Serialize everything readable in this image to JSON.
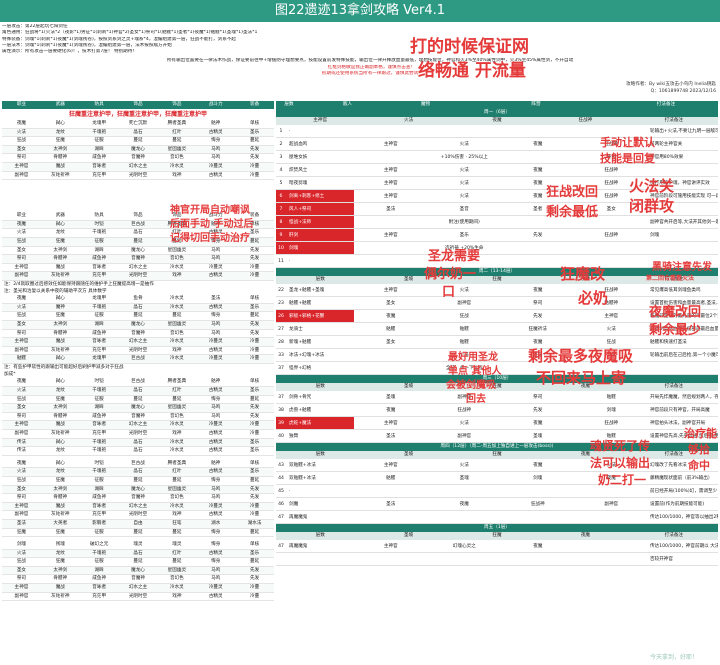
{
  "page": {
    "title": "图22遗迹13拿剑攻略 Ver4.1"
  },
  "intro": [
    "一层攻击：第22层起玩七阳剑任",
    "角色通用：狂战将*1(火法*2（夜影*1)男征*1(刺刹*1)神官*2(圣女*1)祭司*1(骷髅*1)圣者*1(夜魔*1)骷髅*1(圣魂*1)圣法*1",
    "特殊装备：剑魂*1(刺刹*1)夜魔*1(剑魂残卷)，按照剑系剑之灵+魂系*4，混编组建第一层，狂战不能打，剑系不起",
    "一层法术：剑魂*1(刺刹*1)夜魔*1(剑魂残卷)，混编组建第一层，法术按照敌方开始",
    "属性演示：所有攻击一层要硬化(6)！，技术打第7层！ 特别期待！"
  ],
  "info": [
    "所有输出位置要在一律法术作战，保证要前往中+增援防守理想要点，技能设置前发特殊技能，输出位一律开释放血量最低，理想技能位，神官和火3%至40%属性剑中，火3%至45%属性剑，不开自动",
    "红框剑格敏是我正确副本格，谨慎点击查!",
    "初期或还使用系统当所有一律跟过，谨慎此尝试"
  ],
  "credit": {
    "author": "攻略作者：By wiki五攻击小鸟内 Inelia钥匙",
    "date": "Q：1061899748 2023/12/16"
  },
  "left": {
    "columns": [
      "职业",
      "武器",
      "防具",
      "饰品",
      "饰品",
      "战斗力",
      "装备"
    ],
    "banner": "狂魔重注意护甲，狂魔重注意护甲，狂魔重注意护甲",
    "rows": [
      [
        "夜魔",
        "弑心",
        "龙魂甲",
        "死亡沉默",
        "腾者圣典",
        "骷神",
        "单核"
      ],
      [
        "火法",
        "龙纹",
        "千魂袍",
        "晶石",
        "红叶",
        "古精灵",
        "圣乐"
      ],
      [
        "狂战",
        "狂魔",
        "征服",
        "蔓延",
        "蔓延",
        "悔身",
        "蔓延"
      ],
      [
        "圣女",
        "太神剑",
        "湖眸",
        "魔龙心",
        "星固幽灵",
        "马鸣",
        "先发"
      ],
      [
        "祭司",
        "骨髅神",
        "咸鱼神",
        "音魔神",
        "音幻色",
        "马鸣",
        "先发"
      ],
      [
        "主神官",
        "魔战",
        "音咏者",
        "幻水之主",
        "冷水灵",
        "冷蔓灵",
        "冷蔓"
      ],
      [
        "副神官",
        "灰砣祈神",
        "充茫甲",
        "光阴时空",
        "戏神",
        "古精灵",
        "冷蔓"
      ]
    ],
    "rows2": [
      [
        "职业",
        "武器",
        "防具",
        "饰品",
        "饰品",
        "战斗力",
        "装备"
      ],
      [
        "夜魔",
        "弑心",
        "时铠",
        "巨古战",
        "腾者圣典",
        "骷神",
        "单核"
      ],
      [
        "火法",
        "龙纹",
        "千魂袍",
        "晶石",
        "红叶",
        "古精灵",
        "圣乐"
      ],
      [
        "狂战",
        "狂魔",
        "征服",
        "蔓延",
        "蔓延",
        "悔身",
        "蔓延"
      ],
      [
        "圣女",
        "太神剑",
        "湖眸",
        "魔龙心",
        "星固幽灵",
        "马鸣",
        "先发"
      ],
      [
        "祭司",
        "骨髅神",
        "咸鱼神",
        "音魔神",
        "音幻色",
        "马鸣",
        "先发"
      ],
      [
        "主神官",
        "魔战",
        "音咏者",
        "幻水之主",
        "冷水灵",
        "冷蔓灵",
        "冷蔓"
      ],
      [
        "副神官",
        "灰砣祈神",
        "充茫甲",
        "光阴时空",
        "戏神",
        "古精灵",
        "冷蔓"
      ]
    ],
    "note_a": "注：2/4就取圈过后感效任如能保持跟随任的维护手上狂魔提高增一是抽作",
    "note_b": "注：圣光和治复以关系中夜的辅助平次方 具体数学",
    "rows3": [
      [
        "夜魔",
        "弑心",
        "龙魂甲",
        "鱼骨",
        "冷水灵",
        "圣法",
        "单核"
      ],
      [
        "火法",
        "魔神",
        "千魂袍",
        "晶石",
        "冷水灵",
        "古精灵",
        "圣乐"
      ],
      [
        "狂战",
        "狂魔",
        "征服",
        "蔓延",
        "蔓延",
        "悔身",
        "蔓延"
      ],
      [
        "圣女",
        "太神剑",
        "湖眸",
        "魔龙心",
        "星固幽灵",
        "马鸣",
        "先发"
      ],
      [
        "祭司",
        "骨髅神",
        "咸鱼神",
        "音魔神",
        "音幻色",
        "马鸣",
        "先发"
      ],
      [
        "主神官",
        "魔战",
        "音咏者",
        "幻水之主",
        "冷水灵",
        "冷蔓灵",
        "冷蔓"
      ],
      [
        "副神官",
        "灰砣祈神",
        "充茫甲",
        "光阴时空",
        "戏神",
        "古精灵",
        "冷蔓"
      ],
      [
        "骷髅",
        "弑心",
        "龙魂甲",
        "巨古战",
        "冷水灵",
        "冷蔓灵",
        "冷蔓"
      ]
    ],
    "note_c": "注：有些护甲软性的跟输出可能超好后刷护甲减多对于狂战",
    "note_d": "加成*",
    "rows4": [
      [
        "夜魔",
        "弑心",
        "时铠",
        "巨古战",
        "腾者圣典",
        "骷神",
        "单核"
      ],
      [
        "火法",
        "龙纹",
        "千魂袍",
        "晶石",
        "红叶",
        "古精灵",
        "圣乐"
      ],
      [
        "狂战",
        "狂魔",
        "征服",
        "蔓延",
        "蔓延",
        "悔身",
        "蔓延"
      ],
      [
        "圣女",
        "太神剑",
        "湖眸",
        "魔龙心",
        "星固幽灵",
        "马鸣",
        "先发"
      ],
      [
        "祭司",
        "骨髅神",
        "咸鱼神",
        "音魔神",
        "音幻色",
        "马鸣",
        "先发"
      ],
      [
        "主神官",
        "魔战",
        "音咏者",
        "幻水之主",
        "冷水灵",
        "冷蔓灵",
        "冷蔓"
      ],
      [
        "副神官",
        "灰砣祈神",
        "充茫甲",
        "光阴时空",
        "戏神",
        "古精灵",
        "冷蔓"
      ],
      [
        "传法",
        "弑心",
        "千魂袍",
        "晶石",
        "冷水灵",
        "古精灵",
        "圣乐"
      ],
      [
        "传法",
        "龙纹",
        "千魂袍",
        "晶石",
        "冷水灵",
        "古精灵",
        "圣乐"
      ]
    ],
    "rows5": [
      [
        "夜魔",
        "弑心",
        "时铠",
        "巨古战",
        "腾者圣典",
        "骷神",
        "单核"
      ],
      [
        "火法",
        "龙纹",
        "千魂袍",
        "晶石",
        "红叶",
        "古精灵",
        "圣乐"
      ],
      [
        "狂战",
        "狂魔",
        "征服",
        "蔓延",
        "蔓延",
        "悔身",
        "蔓延"
      ],
      [
        "圣女",
        "太神剑",
        "湖眸",
        "魔龙心",
        "星固幽灵",
        "马鸣",
        "先发"
      ],
      [
        "祭司",
        "骨髅神",
        "咸鱼神",
        "音魔神",
        "音幻色",
        "马鸣",
        "先发"
      ],
      [
        "主神官",
        "魔战",
        "音咏者",
        "幻水之主",
        "冷水灵",
        "冷蔓灵",
        "冷蔓"
      ],
      [
        "副神官",
        "灰砣祈神",
        "充茫甲",
        "光阴时空",
        "戏神",
        "古精灵",
        "冷蔓"
      ],
      [
        "圣法",
        "大英者",
        "影翳者",
        "自由",
        "狂笔",
        "湖水",
        "湖水法"
      ],
      [
        "狂魔",
        "狂魔",
        "征服",
        "蔓延",
        "蔓延",
        "悔身",
        "蔓延"
      ]
    ],
    "rows6": [
      [
        "剑魂",
        "残魂",
        "破幻之元",
        "魂灵",
        "魂灵",
        "悔身",
        "单核"
      ],
      [
        "火法",
        "龙纹",
        "千魂袍",
        "晶石",
        "红叶",
        "古精灵",
        "圣乐"
      ],
      [
        "狂战",
        "狂魔",
        "征服",
        "蔓延",
        "蔓延",
        "悔身",
        "蔓延"
      ],
      [
        "圣女",
        "太神剑",
        "湖眸",
        "魔龙心",
        "星固幽灵",
        "马鸣",
        "先发"
      ],
      [
        "祭司",
        "骨髅神",
        "咸鱼神",
        "音魔神",
        "音幻色",
        "马鸣",
        "先发"
      ],
      [
        "主神官",
        "魔战",
        "音咏者",
        "幻水之主",
        "冷水灵",
        "冷蔓灵",
        "冷蔓"
      ],
      [
        "副神官",
        "灰砣祈神",
        "充茫甲",
        "光阴时空",
        "戏神",
        "古精灵",
        "冷蔓"
      ]
    ]
  },
  "right": {
    "header": [
      "层数",
      "敌人",
      "魔物",
      "阵营",
      "打法备注"
    ],
    "sections": [
      {
        "title": "周一（6层）",
        "sub": [
          "主神官",
          "火法",
          "夜魔",
          "狂战神",
          "打法备注"
        ],
        "rows": [
          {
            "num": "1",
            "name": "·",
            "cells": [
              "",
              "",
              "",
              "",
              "轮输出+火法,不要让九明一层敌可以暴"
            ],
            "red": false
          },
          {
            "num": "2",
            "name": "超战血鸣",
            "cells": [
              "主神官",
              "火法",
              "夜魔",
              "狂战神",
              "前两轮主神官关"
            ],
            "red": false
          },
          {
            "num": "3",
            "name": "屋堆女妖",
            "cells": [
              "",
              "+10%伤害 · 25%以上",
              "",
              "祭司",
              "神官用80%效果"
            ],
            "red": false
          },
          {
            "num": "4",
            "name": "炽焚风士",
            "cells": [
              "主神官",
              "火法",
              "夜魔",
              "狂战神",
              ""
            ],
            "red": false
          },
          {
            "num": "5",
            "name": "暗夜剪魂",
            "cells": [
              "主神官",
              "火法",
              "夜魔",
              "狂战神",
              "快打用的护魂，神官讲评实效"
            ],
            "red": false
          },
          {
            "num": "6",
            "name": "剑离+刺客+修土",
            "cells": [
              "主神官",
              "火法",
              "夜魔",
              "狂战神",
              "神官前阶段可施用技能实现 可一段变幻方面"
            ],
            "red": true
          },
          {
            "num": "7",
            "name": "风人+祭司",
            "cells": [
              "圣法",
              "圣音",
              "圣者",
              "圣女",
              ""
            ],
            "red": true
          },
          {
            "num": "8",
            "name": "怪战+法师",
            "cells": [
              "",
              "附注(使用期间)",
              "",
              "",
              "副神官共开启等,大法开其他剑一起开等关开始"
            ],
            "red": true
          },
          {
            "num": "9",
            "name": "肝剑",
            "cells": [
              "主神官",
              "圣乐",
              "先发",
              "狂战神",
              "剑魂"
            ],
            "red": true
          },
          {
            "num": "10",
            "name": "剑魂",
            "cells": [
              "",
              "选祈祷 +20%生命",
              "",
              "",
              ""
            ],
            "red": true
          },
          {
            "num": "11",
            "name": "·",
            "cells": [
              "",
              "",
              "",
              "",
              ""
            ],
            "red": false
          }
        ]
      },
      {
        "title": "周二（13-14层）",
        "sub": [
          "层数",
          "圣坡",
          "狂魔",
          "夜魔",
          "打法备注"
        ],
        "rows": [
          {
            "num": "22",
            "name": "圣龙+骷髅+圣魂",
            "cells": [
              "主神官",
              "火法",
              "夜魔",
              "狂战神",
              "常见爆高低耳剑魂鱼类鸣"
            ],
            "red": false
          },
          {
            "num": "23",
            "name": "骷髅+骷髅",
            "cells": [
              "圣女",
              "副神官",
              "祭司",
              "骷髅神",
              "设置首批伤害和血量最高者,圣法,三十会合"
            ],
            "red": false
          },
          {
            "num": "26",
            "name": "邪极+邪格+花蟹",
            "cells": [
              "夜魔",
              "狂战",
              "先发",
              "主神官",
              "临魔前是前的最先前的可最位2个变化可的 6组"
            ],
            "red": true
          },
          {
            "num": "27",
            "name": "龙骑士",
            "cells": [
              "骷髅",
              "骷髅",
              "狂魔祈法",
              "火法",
              "单改制度的血量最低部前最后血量最后的以"
            ],
            "red": false
          },
          {
            "num": "28",
            "name": "新魂+骷髅",
            "cells": [
              "圣女",
              "骷髅",
              "夜魔",
              "狂战",
              "骷髅和快速打圣法"
            ],
            "red": false
          },
          {
            "num": "33",
            "name": "冰法+幻魂+冰法",
            "cells": [
              "",
              "火法",
              "圣法",
              "火法",
              "轮输出前后在己后抢,第一个小魔可后突恢复的调试"
            ],
            "red": false
          },
          {
            "num": "37",
            "name": "怪界+幻格",
            "cells": [
              "",
              "全法，点一下远程",
              "",
              "",
              ""
            ],
            "red": false
          }
        ]
      },
      {
        "title": "周三（10层）",
        "sub": [
          "层数",
          "圣坡",
          "狂魔",
          "夜魔",
          "打法备注"
        ],
        "rows": [
          {
            "num": "37",
            "name": "剑骨+骨咒",
            "cells": [
              "圣魂",
              "副神官",
              "祭司",
              "骷髅",
              "开局先炸魔魔，然后规划两人，存在魔"
            ],
            "red": false
          },
          {
            "num": "38",
            "name": "虎兽+骷髅",
            "cells": [
              "夜魔",
              "狂战神",
              "先发",
              "剑魂",
              "神官前段只有神官，开局高魔"
            ],
            "red": false
          },
          {
            "num": "39",
            "name": "虎蛇+魔法",
            "cells": [
              "主神官",
              "火法",
              "夜魔",
              "狂战神",
              "神官拍头冰法，副神官开局"
            ],
            "red": true
          },
          {
            "num": "40",
            "name": "独臂",
            "cells": [
              "圣法",
              "副神官",
              "圣魂",
              "骷髅",
              "设置神官先高,先夹普通,然后打,用法技能设置放开"
            ],
            "red": false
          }
        ]
      },
      {
        "title": "周四（12层）（周二-周五加上独自进上一层攻击(boss))",
        "sub": [
          "层数",
          "圣坡",
          "狂魔",
          "夜魔",
          "打法备注"
        ],
        "rows": [
          {
            "num": "43",
            "name": "双骷髅+冰法",
            "cells": [
              "主神官",
              "火法",
              "夜魔",
              "火法",
              "幻魂改了先看冰法"
            ],
            "red": false
          },
          {
            "num": "44",
            "name": "双骷髅+冰法",
            "cells": [
              "骷髅",
              "圣魂",
              "剑魂",
              "夜魔",
              "藤精魔现状面前（前3%输出）"
            ],
            "red": false
          },
          {
            "num": "45",
            "name": "·",
            "cells": [
              "",
              "",
              "",
              "",
              "前已经开局(100%)幻，需调至少"
            ],
            "red": false
          },
          {
            "num": "46",
            "name": "剑魔",
            "cells": [
              "圣法",
              "夜魔",
              "狂战神",
              "副神官",
              "设置前(作为前期技能可能)"
            ],
            "red": false
          },
          {
            "num": "47",
            "name": "再魔魔鬼",
            "cells": [
              "",
              "",
              "",
              "",
              "传达100/1000，神官等以抽出2秒，最低可10%"
            ],
            "red": false
          }
        ]
      },
      {
        "title": "周五（1层）",
        "sub": [
          "层数",
          "圣坡",
          "狂魔",
          "夜魔",
          "打法备注"
        ],
        "rows": [
          {
            "num": "47",
            "name": "再魔魔鬼",
            "cells": [
              "主神官",
              "幻魂心灵之",
              "夜魔",
              "",
              "传达100/1000，神官前期以 大法，血法开神官"
            ],
            "red": false
          },
          {
            "num": "",
            "name": "",
            "cells": [
              "",
              "",
              "",
              "",
              "否较开神官"
            ],
            "red": false
          }
        ]
      }
    ]
  },
  "annotations": [
    "打的时候保证网",
    "络畅通 开流量",
    "手动让默认",
    "技能是回复",
    "火法关",
    "闭群攻",
    "狂战改回",
    "剩余最低",
    "神官开局自动嘲讽",
    "后面手动 手动过后",
    "记得切回手动治疗",
    "圣龙需要",
    "偶尔奶一",
    "口",
    "狂魔改",
    "必奶",
    "黑骑注意先发",
    "第二回合看看火法",
    "夜魔改回",
    "剩余最少",
    "最好用圣龙",
    "单点 其他人",
    "会被剑魔吸",
    "回去",
    "剩余最多夜魔吸",
    "不回来马上寄",
    "魂贤死了传",
    "法可以输出",
    "奶二打一",
    "治疗能",
    "够拾",
    "命中"
  ],
  "footer": "今天拿到，好耶！",
  "colors": {
    "primary": "#1f7f6e",
    "title_bg": "#2f9a84",
    "annotation": "#e53a3a",
    "highlight": "#d9262b"
  }
}
